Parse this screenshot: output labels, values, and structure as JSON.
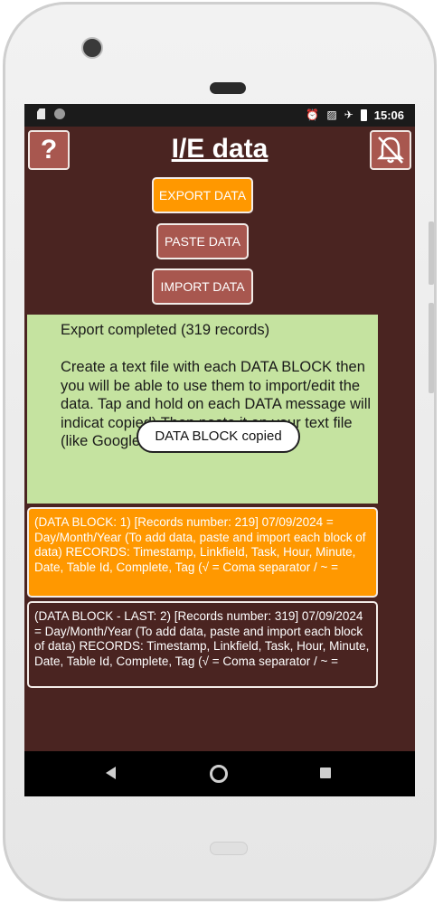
{
  "status": {
    "time": "15:06",
    "icons": [
      "sd-card-icon",
      "circle-icon",
      "alarm-icon",
      "no-sim-icon",
      "airplane-icon",
      "battery-icon"
    ]
  },
  "header": {
    "title": "I/E data",
    "help_label": "?",
    "bell_icon": "bell-off-icon"
  },
  "actions": {
    "export_label": "EXPORT DATA",
    "paste_label": "PASTE DATA",
    "import_label": "IMPORT DATA"
  },
  "info": {
    "line1": "Export completed (319 records)",
    "line2_part1": "Create a text file with each DATA BLOCK then you will be able to use them to import/edit the data. Tap and hold on each DATA ",
    "line2_part2": " message will indicat",
    "line2_part3": "copied) Then paste it on your text file (like Google Docs)"
  },
  "toast": {
    "text": "DATA BLOCK copied"
  },
  "blocks": [
    {
      "text": "(DATA BLOCK: 1) [Records number: 219] 07/09/2024 = Day/Month/Year (To add data, paste and import each block of data) RECORDS: Timestamp, Linkfield, Task, Hour, Minute, Date, Table Id, Complete, Tag (√ = Coma separator / ~ ="
    },
    {
      "text": "(DATA BLOCK - LAST: 2) [Records number: 319] 07/09/2024 = Day/Month/Year (To add data, paste and import each block of data) RECORDS: Timestamp, Linkfield, Task, Hour, Minute, Date, Table Id, Complete, Tag (√ = Coma separator / ~ ="
    }
  ],
  "colors": {
    "app_background": "#4a2421",
    "accent_orange": "#ff9800",
    "button_brown": "#a8574f",
    "info_green": "#c5e3a0"
  }
}
